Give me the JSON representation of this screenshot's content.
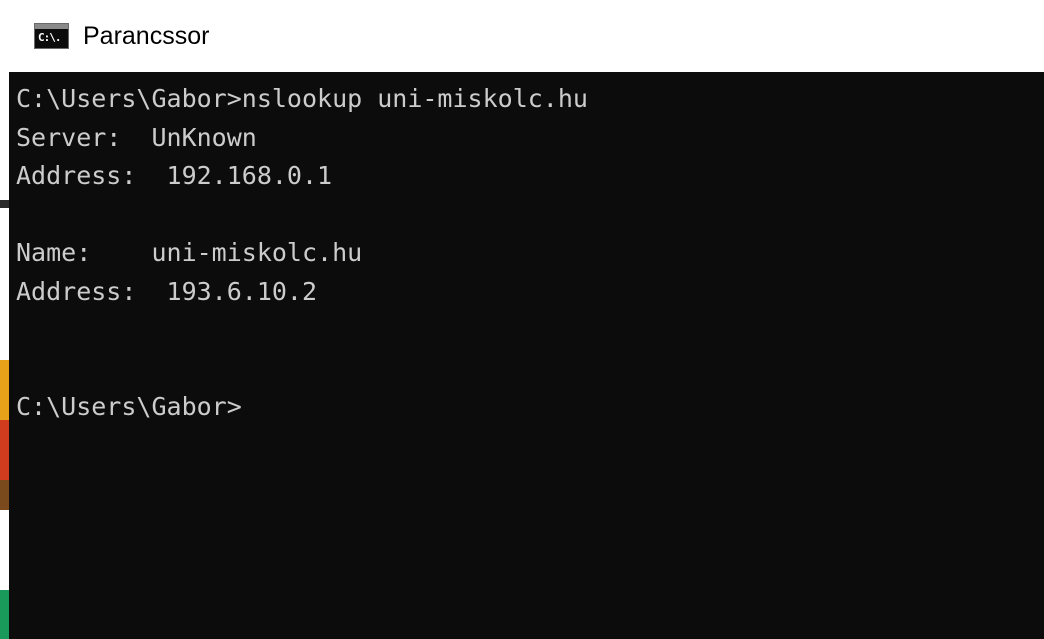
{
  "window": {
    "title": "Parancssor",
    "icon": "cmd-icon",
    "icon_glyph": "C:\\."
  },
  "console": {
    "lines": [
      "C:\\Users\\Gabor>nslookup uni-miskolc.hu",
      "Server:  UnKnown",
      "Address:  192.168.0.1",
      "",
      "Name:    uni-miskolc.hu",
      "Address:  193.6.10.2",
      "",
      "",
      "C:\\Users\\Gabor>"
    ]
  },
  "colors": {
    "console_background": "#0c0c0c",
    "console_text": "#cccccc",
    "titlebar_background": "#ffffff",
    "title_text": "#000000",
    "desktop_strip_accents": [
      "#3a6ea5",
      "#e8a21a",
      "#d13b1e",
      "#7a4a1c",
      "#1a9a5a"
    ]
  }
}
